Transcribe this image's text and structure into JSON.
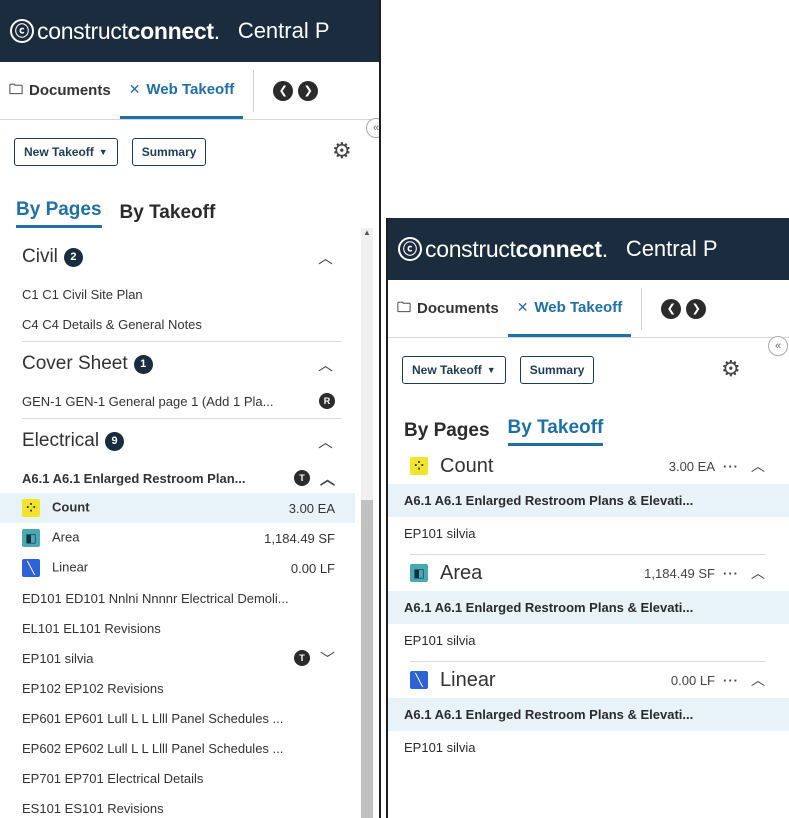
{
  "brand": {
    "logo_mark": "ⓒ",
    "logo_light": "construct",
    "logo_bold": "connect",
    "logo_dot": ".",
    "project_title": "Central P"
  },
  "tabs": {
    "documents_label": "Documents",
    "web_takeoff_label": "Web Takeoff"
  },
  "toolbar": {
    "new_takeoff_label": "New Takeoff",
    "summary_label": "Summary"
  },
  "view_tabs": {
    "by_pages": "By Pages",
    "by_takeoff": "By Takeoff"
  },
  "left_list": {
    "groups": [
      {
        "name": "Civil",
        "count": "2",
        "items": [
          "C1 C1 Civil Site Plan",
          "C4 C4 Details & General Notes"
        ]
      },
      {
        "name": "Cover Sheet",
        "count": "1",
        "items": [
          "GEN-1 GEN-1 General page 1 (Add 1 Pla..."
        ],
        "item_badge": "R"
      },
      {
        "name": "Electrical",
        "count": "9",
        "expanded_page": "A6.1 A6.1 Enlarged Restroom Plan...",
        "expanded_badge": "T",
        "measures": [
          {
            "name": "Count",
            "value": "3.00 EA"
          },
          {
            "name": "Area",
            "value": "1,184.49 SF"
          },
          {
            "name": "Linear",
            "value": "0.00 LF"
          }
        ],
        "items": [
          "ED101 ED101 Nnlni Nnnnr Electrical Demoli...",
          "EL101 EL101 Revisions",
          "EP101 silvia",
          "EP102 EP102 Revisions",
          "EP601 EP601 Lull L L Llll Panel Schedules ...",
          "EP602 EP602 Lull L L Llll Panel Schedules ...",
          "EP701 EP701 Electrical Details",
          "ES101 ES101 Revisions"
        ],
        "ep101_badge": "T"
      }
    ]
  },
  "right_list": {
    "groups": [
      {
        "name": "Count",
        "value": "3.00 EA",
        "page": "A6.1 A6.1 Enlarged Restroom Plans & Elevati...",
        "sub": "EP101 silvia"
      },
      {
        "name": "Area",
        "value": "1,184.49 SF",
        "page": "A6.1 A6.1 Enlarged Restroom Plans & Elevati...",
        "sub": "EP101 silvia"
      },
      {
        "name": "Linear",
        "value": "0.00 LF",
        "page": "A6.1 A6.1 Enlarged Restroom Plans & Elevati...",
        "sub": "EP101 silvia"
      }
    ],
    "more_label": "···"
  },
  "colors": {
    "header_bg": "#1a2c3d",
    "accent": "#1f6fa8",
    "count_icon": "#f1e42a",
    "area_icon": "#4aa8b5",
    "linear_icon": "#2d62d8"
  }
}
